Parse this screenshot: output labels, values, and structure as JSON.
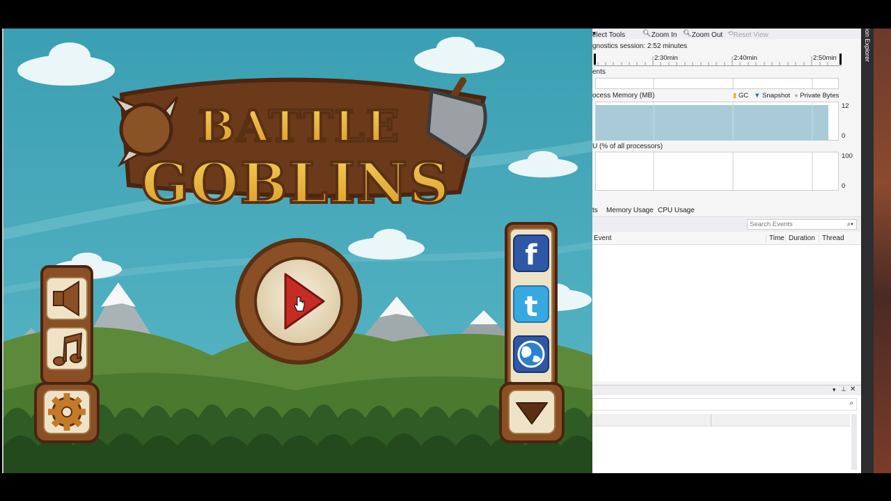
{
  "game": {
    "title_line1": "BATTLE",
    "title_line2": "GOBLINS"
  },
  "toolbar": {
    "select_tools": "elect Tools",
    "zoom_in": "Zoom In",
    "zoom_out": "Zoom Out",
    "reset_view": "Reset View"
  },
  "session": {
    "label": "gnostics session: 2:52 minutes"
  },
  "ruler": {
    "ticks": [
      "2:30min",
      "2:40min",
      "2:50min"
    ]
  },
  "sections": {
    "events": "ents",
    "memory": "ocess Memory (MB)",
    "cpu": "U (% of all processors)"
  },
  "legend": {
    "gc": "GC",
    "snapshot": "Snapshot",
    "private_bytes": "Private Bytes"
  },
  "memory_axis": {
    "max": "12",
    "min": "0"
  },
  "cpu_axis": {
    "max": "100",
    "min": "0"
  },
  "tabs": [
    "ts",
    "Memory Usage",
    "CPU Usage"
  ],
  "search": {
    "placeholder": "Search Events"
  },
  "columns": {
    "event": "Event",
    "time": "Time",
    "duration": "Duration",
    "thread": "Thread"
  },
  "side_panel": {
    "label": "ion Explorer"
  },
  "colors": {
    "sky": "#3aa0b3",
    "wood": "#8a4f24",
    "memory_fill": "#a9cbd8",
    "vs_dark": "#2d2d30"
  }
}
